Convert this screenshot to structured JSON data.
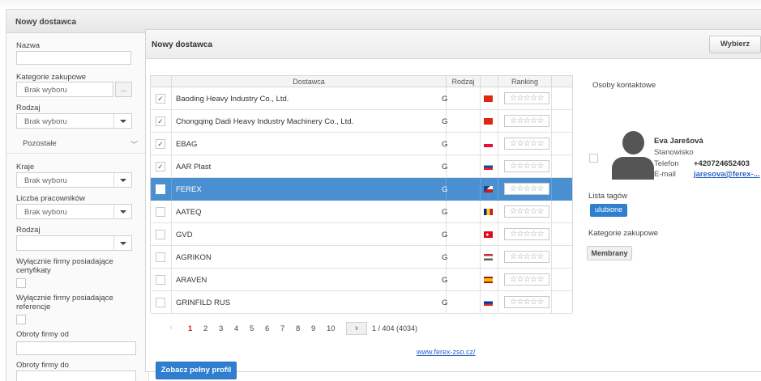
{
  "window": {
    "title": "Nowy dostawca"
  },
  "filters": {
    "nazwa_label": "Nazwa",
    "nazwa_value": "",
    "kategorie_label": "Kategorie zakupowe",
    "kategorie_value": "Brak wyboru",
    "kategorie_btn": "...",
    "rodzaj_label": "Rodzaj",
    "rodzaj_value": "Brak wyboru",
    "pozostale_label": "Pozostałe",
    "kraje_label": "Kraje",
    "kraje_value": "Brak wyboru",
    "liczba_label": "Liczba pracowników",
    "liczba_value": "Brak wyboru",
    "rodzaj2_label": "Rodzaj",
    "rodzaj2_value": "",
    "certyfikaty_label": "Wyłącznie firmy posiadające certyfikaty",
    "referencje_label": "Wyłącznie firmy posiadające referencje",
    "obroty_od_label": "Obroty firmy od",
    "obroty_do_label": "Obroty firmy do"
  },
  "main": {
    "title": "Nowy dostawca",
    "wybierz_label": "Wybierz",
    "columns": {
      "dostawca": "Dostawca",
      "rodzaj": "Rodzaj",
      "ranking": "Ranking"
    },
    "stars": "☆☆☆☆☆",
    "rows": [
      {
        "name": "Baoding Heavy Industry Co., Ltd.",
        "rodzaj": "G",
        "checked": "✓",
        "flag": "cn"
      },
      {
        "name": "Chongqing Dadi Heavy Industry Machinery Co., Ltd.",
        "rodzaj": "G",
        "checked": "✓",
        "flag": "cn"
      },
      {
        "name": "EBAG",
        "rodzaj": "G",
        "checked": "✓",
        "flag": "pl"
      },
      {
        "name": "AAR Plast",
        "rodzaj": "G",
        "checked": "✓",
        "flag": "sk"
      },
      {
        "name": "FEREX",
        "rodzaj": "G",
        "checked": "",
        "flag": "cz",
        "selected": true
      },
      {
        "name": "AATEQ",
        "rodzaj": "G",
        "checked": "",
        "flag": "ro"
      },
      {
        "name": "GVD",
        "rodzaj": "G",
        "checked": "",
        "flag": "tr"
      },
      {
        "name": "AGRIKON",
        "rodzaj": "G",
        "checked": "",
        "flag": "hu"
      },
      {
        "name": "ARAVEN",
        "rodzaj": "G",
        "checked": "",
        "flag": "es"
      },
      {
        "name": "GRINFILD RUS",
        "rodzaj": "G",
        "checked": "",
        "flag": "ru"
      }
    ],
    "pager": {
      "prev": "‹",
      "pages": [
        "1",
        "2",
        "3",
        "4",
        "5",
        "6",
        "7",
        "8",
        "9",
        "10"
      ],
      "next": "›",
      "total": "1 / 404 (4034)"
    },
    "website": "www.ferex-zso.cz/",
    "profile_btn": "Zobacz pełny profil"
  },
  "info": {
    "osoby_label": "Osoby kontaktowe",
    "contact_name": "Eva Jarešová",
    "contact_position": "Stanowisko",
    "telefon_label": "Telefon",
    "telefon_value": "+420724652403",
    "email_label": "E-mail",
    "email_value": "jaresova@ferex-...",
    "tagi_label": "Lista tagów",
    "tag": "ulubione",
    "kategorie_label": "Kategorie zakupowe",
    "kategoria": "Membrany"
  },
  "colors": {
    "accent": "#2f7fd0",
    "selected_row": "#4a90d0",
    "active_page": "#d42020"
  }
}
